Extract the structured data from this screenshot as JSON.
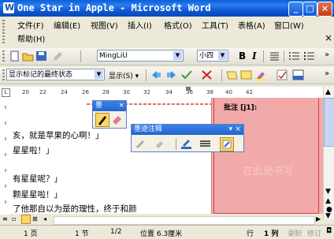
{
  "window": {
    "title": "One Star in Apple - Microsoft Word"
  },
  "menu": {
    "items": [
      "文件(F)",
      "编辑(E)",
      "视图(V)",
      "插入(I)",
      "格式(O)",
      "工具(T)",
      "表格(A)",
      "窗口(W)",
      "帮助(H)"
    ],
    "close_label": "×"
  },
  "formatting_toolbar": {
    "font_name": "MingLiU",
    "font_size": "小四",
    "bold_label": "B",
    "italic_label": "I"
  },
  "reviewing_toolbar": {
    "display_mode": "显示标记的最终状态",
    "show_label": "显示(S)"
  },
  "ruler": {
    "ticks": [
      "20",
      "22",
      "24",
      "26",
      "28",
      "30",
      "32",
      "34",
      "36",
      "38",
      "40",
      "42"
    ]
  },
  "document": {
    "lines": [
      "亥，就是苹果的心啊！」",
      "星星啦！」",
      "有星星呢？」",
      "颗星星啦！」",
      "了他那自以为是的理性，终于和颜"
    ]
  },
  "comment": {
    "label": "批注 [j1]:",
    "placeholder": "在此处书写"
  },
  "ink_palette": {
    "title": "墨"
  },
  "ink_comment_palette": {
    "title": "墨迹注释"
  },
  "status": {
    "page": "1 页",
    "section": "1 节",
    "page_of": "1/2",
    "position": "位置 6.3厘米",
    "line": "行",
    "column": "1 列",
    "rec": "录制",
    "trk": "修订"
  },
  "colors": {
    "title_blue": "#0a5fd8",
    "comment_pane": "#f2a9a9",
    "comment_border": "#d04040"
  }
}
